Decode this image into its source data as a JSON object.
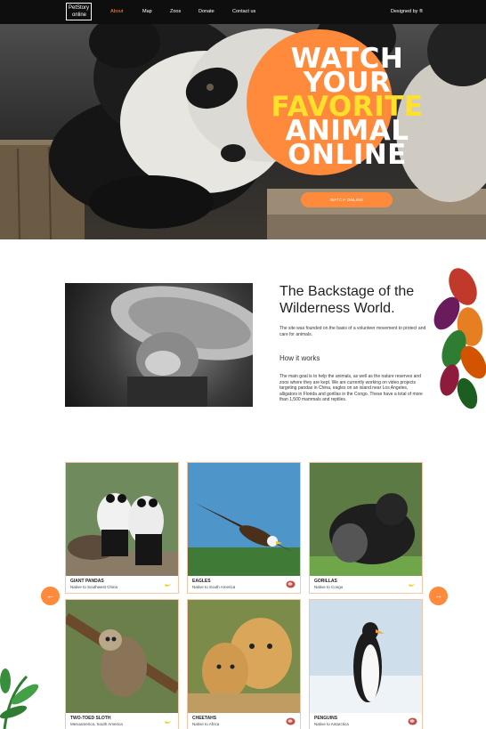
{
  "nav": {
    "logo_line1": "PetStory",
    "logo_line2": "online",
    "items": [
      "About",
      "Map",
      "Zoos",
      "Donate",
      "Contact us"
    ],
    "designed_by": "Designed by ®"
  },
  "hero": {
    "title_lines": [
      "WATCH",
      "YOUR",
      "FAVORITE",
      "ANIMAL",
      "ONLINE"
    ],
    "cta_label": "WATCH ONLINE"
  },
  "about": {
    "title": "The Backstage of the Wilderness World.",
    "intro": "The site was founded on the basis of a volunteer movement to protect and care for animals.",
    "how_title": "How it works",
    "how_text": "The main goal is to help the animals, as well as the nature reserves and zoos where they are kept. We are currently working on video projects targeting pandas in China, eagles on an island near Los Angeles, alligators in Florida and gorillas in the Congo. These have a total of more than 1,500 mammals and reptiles."
  },
  "cards": [
    {
      "name": "GIANT PANDAS",
      "native": "Native to Southwest China",
      "icon": "banana-icon"
    },
    {
      "name": "EAGLES",
      "native": "Native to South America",
      "icon": "meat-icon"
    },
    {
      "name": "GORILLAS",
      "native": "Native to Congo",
      "icon": "banana-icon"
    },
    {
      "name": "TWO-TOED SLOTH",
      "native": "Mesoamerica, South America",
      "icon": "banana-icon"
    },
    {
      "name": "CHEETAHS",
      "native": "Native to Africa",
      "icon": "meat-icon"
    },
    {
      "name": "PENGUINS",
      "native": "Native to Antarctica",
      "icon": "meat-icon"
    }
  ],
  "carousel": {
    "prev": "←",
    "next": "→"
  },
  "colors": {
    "accent": "#ff8a3c",
    "highlight": "#ffe12b",
    "nav_bg": "#0e0e0e"
  }
}
